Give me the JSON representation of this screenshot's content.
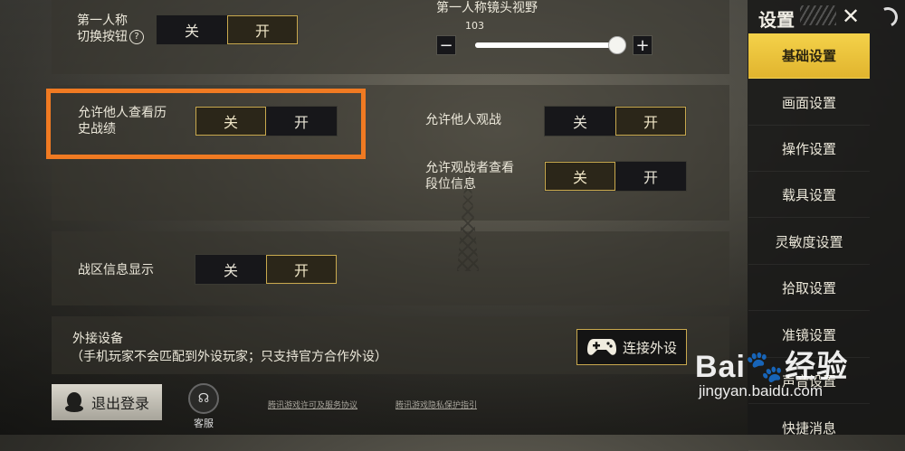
{
  "fpp": {
    "label_line1": "第一人称",
    "label_line2": "切换按钮",
    "help_glyph": "?",
    "off": "关",
    "on": "开",
    "selected": "on",
    "fov_label": "第一人称镜头视野",
    "fov_value": "103",
    "fov_fraction": 0.94,
    "minus": "−",
    "plus": "+"
  },
  "history": {
    "label_line1": "允许他人查看历",
    "label_line2": "史战绩",
    "off": "关",
    "on": "开",
    "selected": "off"
  },
  "spectate": {
    "label": "允许他人观战",
    "off": "关",
    "on": "开",
    "selected": "on"
  },
  "rank_info": {
    "label_line1": "允许观战者查看",
    "label_line2": "段位信息",
    "off": "关",
    "on": "开",
    "selected": "off"
  },
  "region": {
    "label": "战区信息显示",
    "off": "关",
    "on": "开",
    "selected": "on"
  },
  "peripheral": {
    "title": "外接设备",
    "note": "（手机玩家不会匹配到外设玩家；只支持官方合作外设）",
    "connect_label": "连接外设",
    "connect_icon": "gamepad-icon"
  },
  "footer": {
    "logout_label": "退出登录",
    "logout_icon": "qq-penguin-icon",
    "service_label": "客服",
    "link_terms": "腾讯游戏许可及服务协议",
    "link_privacy": "腾讯游戏隐私保护指引"
  },
  "sidebar": {
    "title": "设置",
    "close": "✕",
    "items": [
      "基础设置",
      "画面设置",
      "操作设置",
      "载具设置",
      "灵敏度设置",
      "拾取设置",
      "准镜设置",
      "声音设置",
      "快捷消息"
    ],
    "active_index": 0
  },
  "watermark": {
    "logo": "Bai🐾经验",
    "url": "jingyan.baidu.com"
  },
  "colors": {
    "accent_gold": "#c9a94e",
    "active_tab": "#f4d24a",
    "highlight_orange": "#f07a22"
  }
}
